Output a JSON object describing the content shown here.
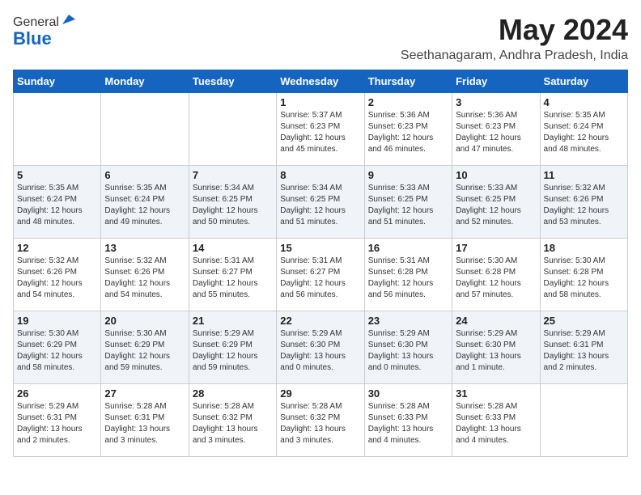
{
  "logo": {
    "general": "General",
    "blue": "Blue"
  },
  "header": {
    "month": "May 2024",
    "location": "Seethanagaram, Andhra Pradesh, India"
  },
  "days_of_week": [
    "Sunday",
    "Monday",
    "Tuesday",
    "Wednesday",
    "Thursday",
    "Friday",
    "Saturday"
  ],
  "weeks": [
    [
      {
        "day": "",
        "info": ""
      },
      {
        "day": "",
        "info": ""
      },
      {
        "day": "",
        "info": ""
      },
      {
        "day": "1",
        "info": "Sunrise: 5:37 AM\nSunset: 6:23 PM\nDaylight: 12 hours\nand 45 minutes."
      },
      {
        "day": "2",
        "info": "Sunrise: 5:36 AM\nSunset: 6:23 PM\nDaylight: 12 hours\nand 46 minutes."
      },
      {
        "day": "3",
        "info": "Sunrise: 5:36 AM\nSunset: 6:23 PM\nDaylight: 12 hours\nand 47 minutes."
      },
      {
        "day": "4",
        "info": "Sunrise: 5:35 AM\nSunset: 6:24 PM\nDaylight: 12 hours\nand 48 minutes."
      }
    ],
    [
      {
        "day": "5",
        "info": "Sunrise: 5:35 AM\nSunset: 6:24 PM\nDaylight: 12 hours\nand 48 minutes."
      },
      {
        "day": "6",
        "info": "Sunrise: 5:35 AM\nSunset: 6:24 PM\nDaylight: 12 hours\nand 49 minutes."
      },
      {
        "day": "7",
        "info": "Sunrise: 5:34 AM\nSunset: 6:25 PM\nDaylight: 12 hours\nand 50 minutes."
      },
      {
        "day": "8",
        "info": "Sunrise: 5:34 AM\nSunset: 6:25 PM\nDaylight: 12 hours\nand 51 minutes."
      },
      {
        "day": "9",
        "info": "Sunrise: 5:33 AM\nSunset: 6:25 PM\nDaylight: 12 hours\nand 51 minutes."
      },
      {
        "day": "10",
        "info": "Sunrise: 5:33 AM\nSunset: 6:25 PM\nDaylight: 12 hours\nand 52 minutes."
      },
      {
        "day": "11",
        "info": "Sunrise: 5:32 AM\nSunset: 6:26 PM\nDaylight: 12 hours\nand 53 minutes."
      }
    ],
    [
      {
        "day": "12",
        "info": "Sunrise: 5:32 AM\nSunset: 6:26 PM\nDaylight: 12 hours\nand 54 minutes."
      },
      {
        "day": "13",
        "info": "Sunrise: 5:32 AM\nSunset: 6:26 PM\nDaylight: 12 hours\nand 54 minutes."
      },
      {
        "day": "14",
        "info": "Sunrise: 5:31 AM\nSunset: 6:27 PM\nDaylight: 12 hours\nand 55 minutes."
      },
      {
        "day": "15",
        "info": "Sunrise: 5:31 AM\nSunset: 6:27 PM\nDaylight: 12 hours\nand 56 minutes."
      },
      {
        "day": "16",
        "info": "Sunrise: 5:31 AM\nSunset: 6:28 PM\nDaylight: 12 hours\nand 56 minutes."
      },
      {
        "day": "17",
        "info": "Sunrise: 5:30 AM\nSunset: 6:28 PM\nDaylight: 12 hours\nand 57 minutes."
      },
      {
        "day": "18",
        "info": "Sunrise: 5:30 AM\nSunset: 6:28 PM\nDaylight: 12 hours\nand 58 minutes."
      }
    ],
    [
      {
        "day": "19",
        "info": "Sunrise: 5:30 AM\nSunset: 6:29 PM\nDaylight: 12 hours\nand 58 minutes."
      },
      {
        "day": "20",
        "info": "Sunrise: 5:30 AM\nSunset: 6:29 PM\nDaylight: 12 hours\nand 59 minutes."
      },
      {
        "day": "21",
        "info": "Sunrise: 5:29 AM\nSunset: 6:29 PM\nDaylight: 12 hours\nand 59 minutes."
      },
      {
        "day": "22",
        "info": "Sunrise: 5:29 AM\nSunset: 6:30 PM\nDaylight: 13 hours\nand 0 minutes."
      },
      {
        "day": "23",
        "info": "Sunrise: 5:29 AM\nSunset: 6:30 PM\nDaylight: 13 hours\nand 0 minutes."
      },
      {
        "day": "24",
        "info": "Sunrise: 5:29 AM\nSunset: 6:30 PM\nDaylight: 13 hours\nand 1 minute."
      },
      {
        "day": "25",
        "info": "Sunrise: 5:29 AM\nSunset: 6:31 PM\nDaylight: 13 hours\nand 2 minutes."
      }
    ],
    [
      {
        "day": "26",
        "info": "Sunrise: 5:29 AM\nSunset: 6:31 PM\nDaylight: 13 hours\nand 2 minutes."
      },
      {
        "day": "27",
        "info": "Sunrise: 5:28 AM\nSunset: 6:31 PM\nDaylight: 13 hours\nand 3 minutes."
      },
      {
        "day": "28",
        "info": "Sunrise: 5:28 AM\nSunset: 6:32 PM\nDaylight: 13 hours\nand 3 minutes."
      },
      {
        "day": "29",
        "info": "Sunrise: 5:28 AM\nSunset: 6:32 PM\nDaylight: 13 hours\nand 3 minutes."
      },
      {
        "day": "30",
        "info": "Sunrise: 5:28 AM\nSunset: 6:33 PM\nDaylight: 13 hours\nand 4 minutes."
      },
      {
        "day": "31",
        "info": "Sunrise: 5:28 AM\nSunset: 6:33 PM\nDaylight: 13 hours\nand 4 minutes."
      },
      {
        "day": "",
        "info": ""
      }
    ]
  ]
}
